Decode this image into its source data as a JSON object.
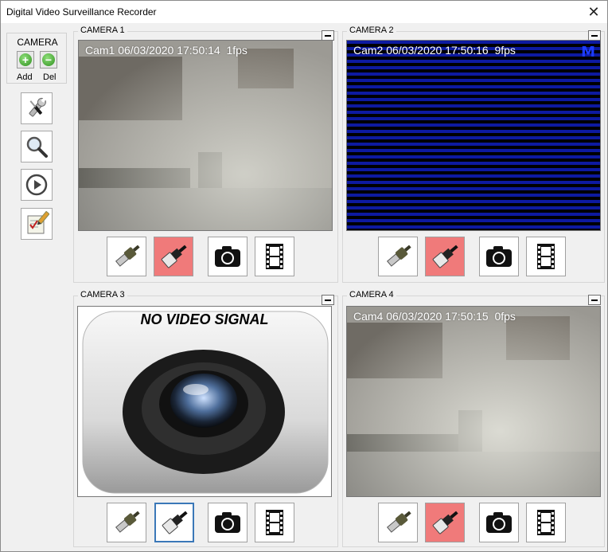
{
  "window": {
    "title": "Digital Video Surveillance Recorder",
    "close_glyph": "✕"
  },
  "toolbar": {
    "group_label": "CAMERA",
    "add_label": "Add",
    "del_label": "Del",
    "add_glyph": "+",
    "del_glyph": "−",
    "tools": [
      {
        "name": "settings-tools-icon"
      },
      {
        "name": "search-zoom-icon"
      },
      {
        "name": "play-icon"
      },
      {
        "name": "notes-edit-icon"
      }
    ]
  },
  "cameras": [
    {
      "label": "CAMERA 1",
      "overlay": "Cam1 06/03/2020 17:50:14  1fps",
      "state": "feed"
    },
    {
      "label": "CAMERA 2",
      "overlay": "Cam2 06/03/2020 17:50:16  9fps",
      "state": "scanlines",
      "badge": "M"
    },
    {
      "label": "CAMERA 3",
      "overlay": "",
      "state": "no-signal",
      "no_signal_text": "NO VIDEO SIGNAL"
    },
    {
      "label": "CAMERA 4",
      "overlay": "Cam4 06/03/2020 17:50:15  0fps",
      "state": "feed"
    }
  ],
  "colors": {
    "scan_blue": "#0d1aa0",
    "record_red": "#f07a7a",
    "selected_border": "#3b78b8",
    "badge_blue": "#1c3cff"
  }
}
